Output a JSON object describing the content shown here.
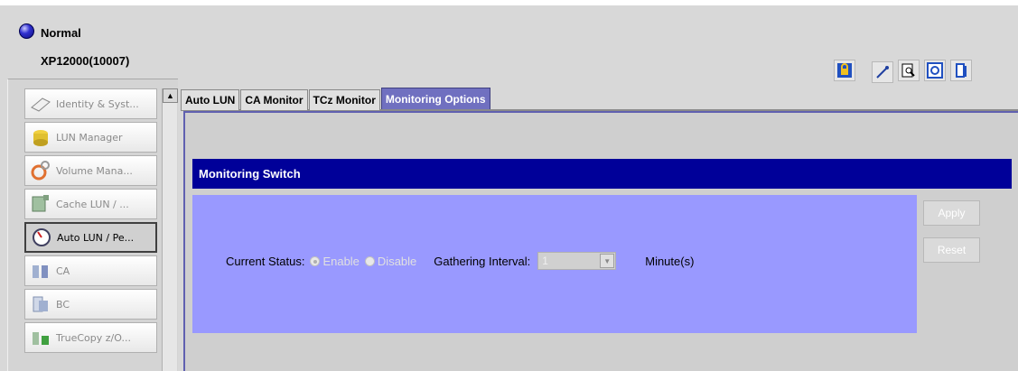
{
  "header": {
    "status": "Normal",
    "device": "XP12000(10007)"
  },
  "toolbar": {
    "icons": [
      "lock-icon",
      "wrench-icon",
      "search-report-icon",
      "refresh-icon",
      "exit-icon"
    ]
  },
  "sidebar": {
    "items": [
      {
        "label": "Identity & Syst...",
        "icon": "identity-icon"
      },
      {
        "label": "LUN Manager",
        "icon": "lun-manager-icon"
      },
      {
        "label": "Volume Mana...",
        "icon": "volume-manager-icon"
      },
      {
        "label": "Cache LUN / ...",
        "icon": "cache-lun-icon"
      },
      {
        "label": "Auto LUN / Pe...",
        "icon": "auto-lun-icon",
        "active": true
      },
      {
        "label": "CA",
        "icon": "ca-icon"
      },
      {
        "label": "BC",
        "icon": "bc-icon"
      },
      {
        "label": "TrueCopy z/O...",
        "icon": "truecopy-icon"
      }
    ]
  },
  "tabs": [
    {
      "label": "Auto LUN"
    },
    {
      "label": "CA Monitor"
    },
    {
      "label": "TCz Monitor"
    },
    {
      "label": "Monitoring Options",
      "active": true
    }
  ],
  "monitoring": {
    "section_title": "Monitoring Switch",
    "current_status_label": "Current Status:",
    "enable_label": "Enable",
    "disable_label": "Disable",
    "selected_status": "Enable",
    "interval_label": "Gathering Interval:",
    "interval_value": "1",
    "unit_label": "Minute(s)"
  },
  "buttons": {
    "apply": "Apply",
    "reset": "Reset"
  },
  "colors": {
    "section_bar": "#000099",
    "panel": "#9999ff",
    "active_tab": "#7070c0"
  }
}
